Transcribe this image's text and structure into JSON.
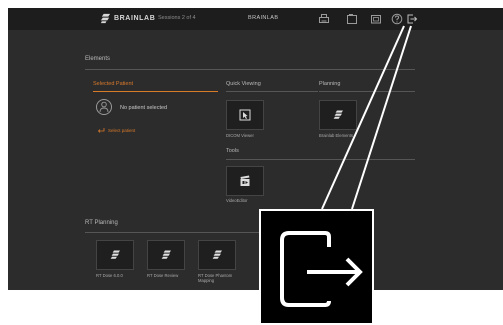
{
  "topbar": {
    "logo_text": "BRAINLAB",
    "session": "Sessions 2 of 4",
    "title": "BRAINLAB",
    "icons": [
      "print-icon",
      "screenshot-icon",
      "window-icon",
      "help-icon",
      "logout-icon"
    ]
  },
  "elements": {
    "title": "Elements",
    "selected_patient": {
      "header": "Selected Patient",
      "status": "No patient selected",
      "select_link": "Select patient"
    },
    "quick_viewing": {
      "header": "Quick Viewing",
      "items": [
        {
          "label": "DICOM Viewer",
          "icon": "viewer-icon"
        }
      ]
    },
    "planning": {
      "header": "Planning",
      "items": [
        {
          "label": "Brainlab Elements",
          "icon": "brainlab-logo-icon"
        }
      ]
    },
    "tools": {
      "header": "Tools",
      "items": [
        {
          "label": "VideoEditor",
          "icon": "video-editor-icon"
        }
      ]
    }
  },
  "rt_planning": {
    "title": "RT Planning",
    "items": [
      {
        "label": "RT Dose 6.0.0",
        "icon": "brainlab-logo-icon"
      },
      {
        "label": "RT Dose Review",
        "icon": "brainlab-logo-icon"
      },
      {
        "label": "RT Dose Phantom Mapping",
        "icon": "brainlab-logo-icon"
      }
    ]
  },
  "callout": {
    "icon": "logout-icon"
  },
  "colors": {
    "accent": "#d97a2b",
    "background": "#2c2c2c",
    "topbar": "#1d1d1d"
  }
}
